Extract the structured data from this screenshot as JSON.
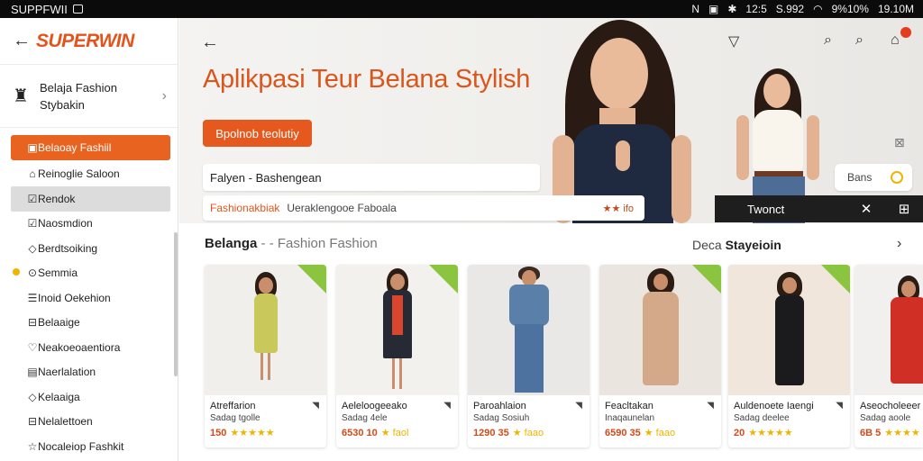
{
  "statusbar": {
    "app": "SUPPFWII",
    "right": [
      "12:5",
      "S.992",
      "9%10%",
      "19.10M"
    ]
  },
  "sidebar": {
    "logo": "SUPERWIN",
    "profile": {
      "line1": "Belaja Fashion",
      "line2": "Stybakin"
    },
    "items": [
      {
        "label": "Belaoay Fashiil",
        "icon": "calendar-icon"
      },
      {
        "label": "Reinoglie Saloon",
        "icon": "home-icon"
      },
      {
        "label": "Rendok",
        "icon": "checkbox-icon"
      },
      {
        "label": "Naosmdion",
        "icon": "check-icon"
      },
      {
        "label": "Berdtsoiking",
        "icon": "tag-icon"
      },
      {
        "label": "Semmia",
        "icon": "target-icon"
      },
      {
        "label": "Inoid Oekehion",
        "icon": "list-icon"
      },
      {
        "label": "Belaaige",
        "icon": "grid-icon"
      },
      {
        "label": "Neakoeoaentiora",
        "icon": "heart-icon"
      },
      {
        "label": "Naerlalation",
        "icon": "doc-icon"
      },
      {
        "label": "Kelaaiga",
        "icon": "tag-icon"
      },
      {
        "label": "Nelalettoen",
        "icon": "bag-icon"
      },
      {
        "label": "Nocaleiop Fashkit",
        "icon": "star-icon"
      }
    ]
  },
  "hero": {
    "title": "Aplikpasi Teur Belana Stylish",
    "cta": "Bpolnob teolutiy",
    "search_value": "Falyen - Bashengean",
    "search2_a": "Fashionakbiak",
    "search2_b": "Ueraklengooe Faboala",
    "search2_c": "★★ ifo",
    "pill_label": "Bans",
    "dark_label": "Twonct"
  },
  "section": {
    "title_bold": "Belanga",
    "title_sep": " - - ",
    "title_muted": "Fashion Fashion",
    "right_muted": "Deca ",
    "right_bold": "Stayeioin"
  },
  "products": [
    {
      "name": "Atreffarion",
      "sub": "Sadag tgolle",
      "price": "150",
      "stars": "★★★★★",
      "dress": "#c9c85b",
      "tag": true
    },
    {
      "name": "Aeleloogeeako",
      "sub": "Sadag 4ele",
      "price": "6530 10",
      "stars": "★ faol",
      "dress": "#262a35",
      "tag": true
    },
    {
      "name": "Paroahlaion",
      "sub": "Sadag Sosiuh",
      "price": "1290 35",
      "stars": "★ faao",
      "dress": "#5a7fa8",
      "tag": false
    },
    {
      "name": "Feacltakan",
      "sub": "Inaqaunelan",
      "price": "6590 35",
      "stars": "★ faao",
      "dress": "#d4a98a",
      "tag": true
    },
    {
      "name": "Auldenoete Iaengi",
      "sub": "Sadag deelee",
      "price": "20",
      "stars": "★★★★★",
      "dress": "#1b1b1e",
      "tag": false
    },
    {
      "name": "Aseocholeeer",
      "sub": "Sadag aoole",
      "price": "6B 5",
      "stars": "★★★★",
      "dress": "#cf2f24",
      "tag": false
    }
  ],
  "colors": {
    "accent": "#e5581e",
    "tag": "#8bc43f",
    "star": "#f0b400"
  }
}
